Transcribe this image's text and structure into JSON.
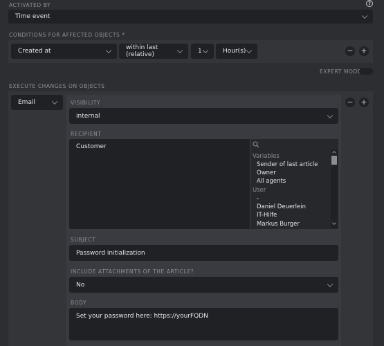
{
  "activated_by": {
    "label": "ACTIVATED BY",
    "value": "Time event",
    "help_symbol": "?"
  },
  "conditions": {
    "label": "CONDITIONS FOR AFFECTED OBJECTS *",
    "attribute": "Created at",
    "operator": "within last (relative)",
    "amount": "1",
    "unit": "Hour(s)",
    "remove_symbol": "−",
    "add_symbol": "+"
  },
  "expert_mode": {
    "label": "EXPERT MODE",
    "enabled": false
  },
  "execute": {
    "label": "EXECUTE CHANGES ON OBJECTS",
    "action": "Email",
    "remove_symbol": "−",
    "add_symbol": "+",
    "visibility": {
      "label": "VISIBILITY",
      "value": "internal"
    },
    "recipient": {
      "label": "RECIPIENT",
      "selected": "Customer",
      "options": [
        {
          "text": "Variables",
          "group": true
        },
        {
          "text": "Sender of last article",
          "group": false
        },
        {
          "text": "Owner",
          "group": false
        },
        {
          "text": "All agents",
          "group": false
        },
        {
          "text": "User",
          "group": true
        },
        {
          "text": "-",
          "group": false
        },
        {
          "text": "Daniel Deuerlein",
          "group": false
        },
        {
          "text": "IT-Hilfe",
          "group": false
        },
        {
          "text": "Markus Burger",
          "group": false
        }
      ]
    },
    "subject": {
      "label": "SUBJECT",
      "value": "Password initialization"
    },
    "attachments": {
      "label": "INCLUDE ATTACHMENTS OF THE ARTICLE?",
      "value": "No"
    },
    "body": {
      "label": "BODY",
      "value": "Set your password here: https://yourFQDN"
    }
  }
}
